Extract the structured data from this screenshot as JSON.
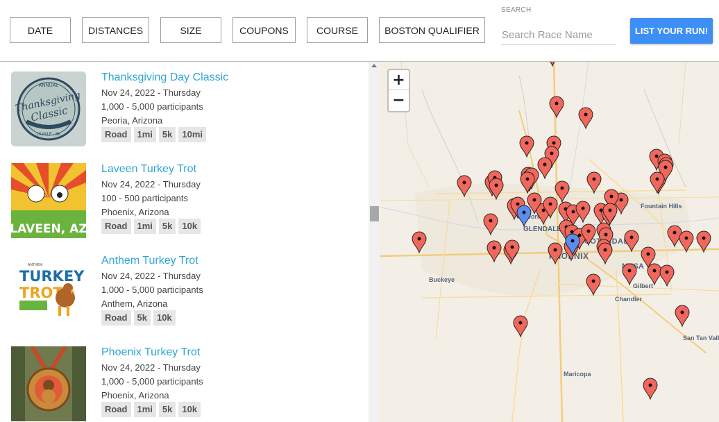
{
  "filters": [
    {
      "label": "DATE"
    },
    {
      "label": "DISTANCES"
    },
    {
      "label": "SIZE"
    },
    {
      "label": "COUPONS"
    },
    {
      "label": "COURSE"
    },
    {
      "label": "BOSTON QUALIFIER"
    }
  ],
  "search": {
    "label": "SEARCH",
    "placeholder": "Search Race Name"
  },
  "list_run_label": "LIST YOUR RUN!",
  "races": [
    {
      "title": "Thanksgiving Day Classic",
      "date": "Nov 24, 2022 - Thursday",
      "participants": "1,000 - 5,000 participants",
      "location": "Peoria, Arizona",
      "tags": [
        "Road",
        "1mi",
        "5k",
        "10mi"
      ],
      "thumb_text": [
        "ANNUAL",
        "Thanksgiving",
        "Classic",
        "10 MILE · 5K"
      ]
    },
    {
      "title": "Laveen Turkey Trot",
      "date": "Nov 24, 2022 - Thursday",
      "participants": "100 - 500 participants",
      "location": "Phoenix, Arizona",
      "tags": [
        "Road",
        "1mi",
        "5k",
        "10k"
      ],
      "thumb_text": [
        "LAVEEN, AZ"
      ]
    },
    {
      "title": "Anthem Turkey Trot",
      "date": "Nov 24, 2022 - Thursday",
      "participants": "1,000 - 5,000 participants",
      "location": "Anthem, Arizona",
      "tags": [
        "Road",
        "5k",
        "10k"
      ],
      "thumb_text": [
        "ANTHEM",
        "TURKEY",
        "TROT"
      ]
    },
    {
      "title": "Phoenix Turkey Trot",
      "date": "Nov 24, 2022 - Thursday",
      "participants": "1,000 - 5,000 participants",
      "location": "Phoenix, Arizona",
      "tags": [
        "Road",
        "1mi",
        "5k",
        "10k"
      ],
      "thumb_text": []
    }
  ],
  "map": {
    "zoom_in": "+",
    "zoom_out": "−",
    "labels": [
      "Fountain Hills",
      "SCOTTSDALE",
      "PHOENIX",
      "MESA",
      "Gilbert",
      "Chandler",
      "Buckeye",
      "Maricopa",
      "San Tan Valley",
      "GLENDALE",
      "Peoria"
    ],
    "pin_color": "#f2675c",
    "selected_pin_color": "#5b8def"
  }
}
